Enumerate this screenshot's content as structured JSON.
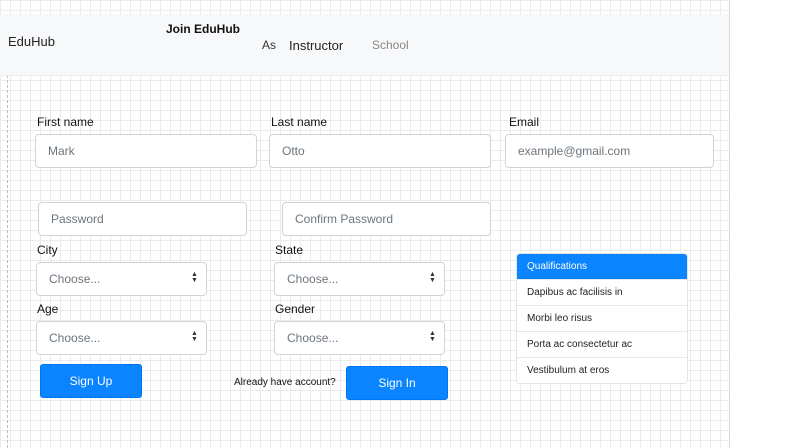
{
  "header": {
    "brand": "EduHub",
    "join_title": "Join EduHub",
    "as_text": "As",
    "role_instructor": "Instructor",
    "role_school": "School"
  },
  "form": {
    "first_name": {
      "label": "First name",
      "placeholder": "Mark"
    },
    "last_name": {
      "label": "Last name",
      "placeholder": "Otto"
    },
    "email": {
      "label": "Email",
      "placeholder": "example@gmail.com"
    },
    "password": {
      "placeholder": "Password"
    },
    "confirm_password": {
      "placeholder": "Confirm Password"
    },
    "city": {
      "label": "City",
      "selected": "Choose..."
    },
    "state": {
      "label": "State",
      "selected": "Choose..."
    },
    "age": {
      "label": "Age",
      "selected": "Choose..."
    },
    "gender": {
      "label": "Gender",
      "selected": "Choose..."
    },
    "signup_label": "Sign Up",
    "already_text": "Already have account?",
    "signin_label": "Sign In"
  },
  "qualifications": {
    "header": "Qualifications",
    "items": [
      "Dapibus ac facilisis in",
      "Morbi leo risus",
      "Porta ac consectetur ac",
      "Vestibulum at eros"
    ]
  },
  "colors": {
    "accent": "#0a84ff",
    "header_bg": "#f7f8fa"
  },
  "icons": {
    "select_caret": "select-caret-icon"
  }
}
